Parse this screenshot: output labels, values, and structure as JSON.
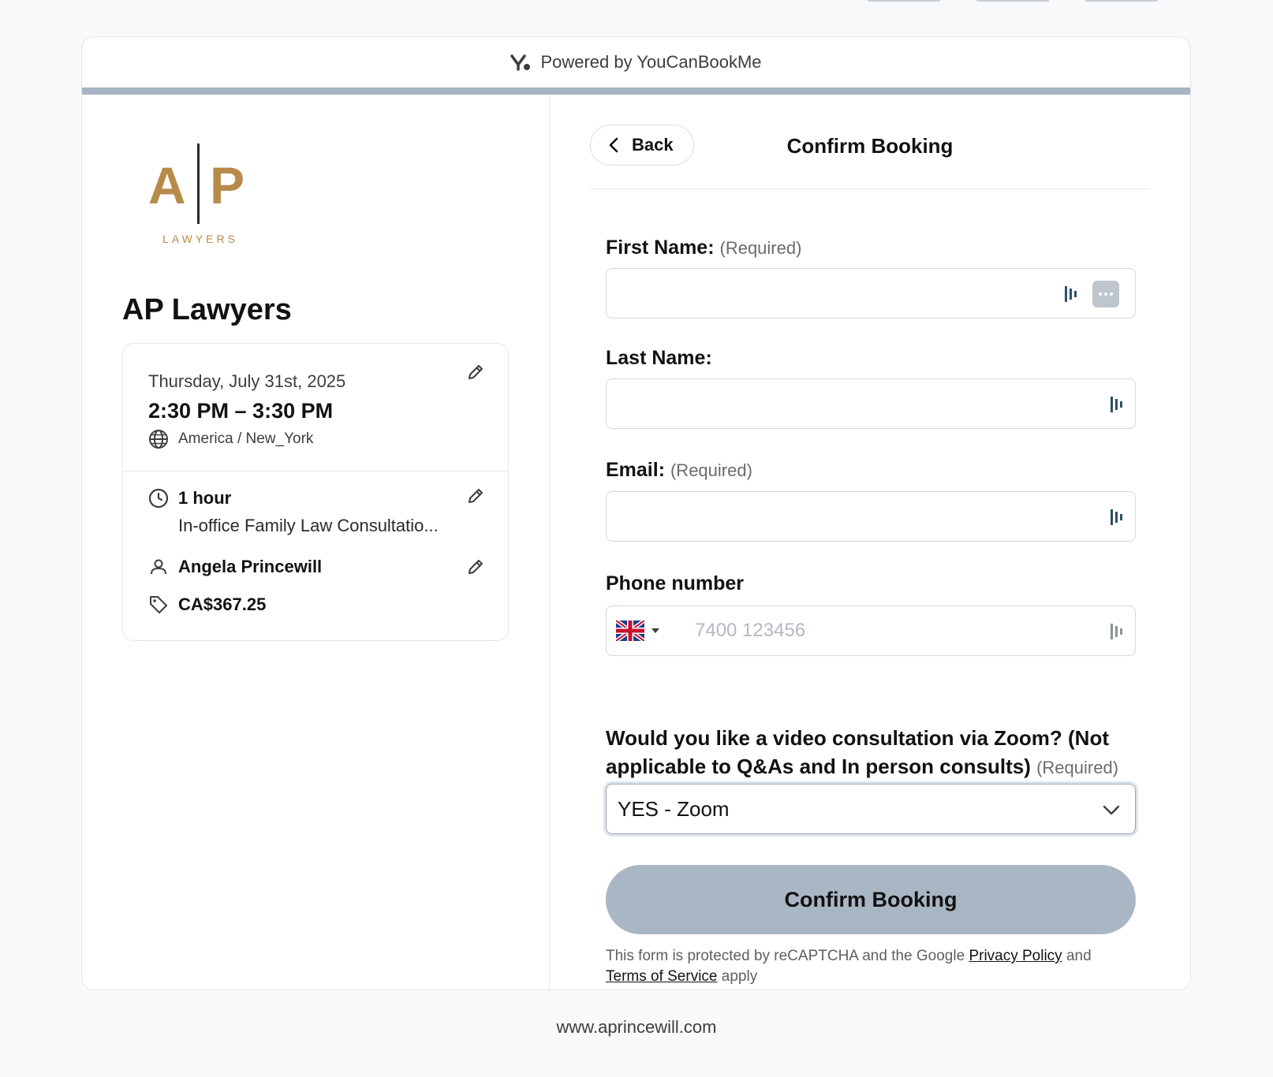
{
  "header": {
    "powered_by": "Powered by YouCanBookMe"
  },
  "company": {
    "logo_letters_left": "A",
    "logo_letters_right": "P",
    "logo_subtitle": "LAWYERS",
    "name": "AP Lawyers"
  },
  "summary": {
    "date": "Thursday, July 31st, 2025",
    "time": "2:30 PM – 3:30 PM",
    "timezone": "America / New_York",
    "duration": "1 hour",
    "service": "In-office Family Law Consultatio...",
    "staff": "Angela Princewill",
    "price": "CA$367.25"
  },
  "form": {
    "back_label": "Back",
    "title": "Confirm Booking",
    "required_text": "(Required)",
    "first_name_label": "First Name:",
    "last_name_label": "Last Name:",
    "email_label": "Email:",
    "phone_label": "Phone number",
    "phone_placeholder": "7400 123456",
    "question_label": "Would you like a video consultation via Zoom? (Not applicable to Q&As and In person consults)",
    "question_value": "YES - Zoom",
    "confirm_label": "Confirm Booking",
    "legal_prefix": "This form is protected by reCAPTCHA and the Google",
    "privacy_link": "Privacy Policy",
    "legal_and": "and",
    "terms_link": "Terms of Service",
    "legal_suffix": "apply"
  },
  "footer": {
    "url": "www.aprincewill.com"
  },
  "colors": {
    "progress_bar": "#a6b4c4",
    "confirm_button": "#a9b6c4",
    "logo_gold": "#b88a4a",
    "password_manager_icon": "#2c5263"
  },
  "icons": {
    "header": "youcanbookme-logo-icon",
    "back": "chevron-left-icon",
    "edit": "pencil-icon",
    "timezone": "globe-icon",
    "duration": "clock-icon",
    "staff": "person-icon",
    "price": "tag-icon",
    "dropdown": "chevron-down-icon",
    "flag": "uk-flag-icon"
  }
}
